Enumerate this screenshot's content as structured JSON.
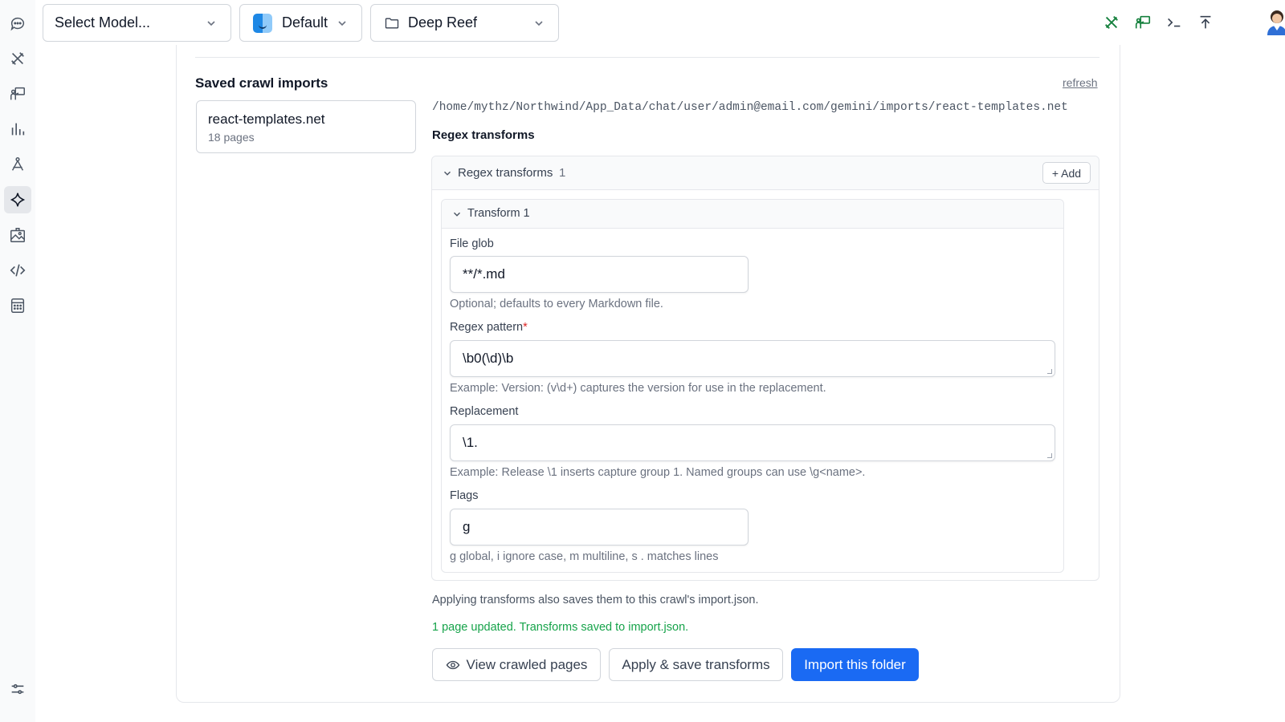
{
  "rail": {
    "items": [
      {
        "icon": "chat-icon"
      },
      {
        "icon": "tools-icon"
      },
      {
        "icon": "teacher-icon"
      },
      {
        "icon": "analytics-icon"
      },
      {
        "icon": "compass-icon"
      },
      {
        "icon": "sparkle-icon",
        "active": true
      },
      {
        "icon": "image-gallery-icon"
      },
      {
        "icon": "code-icon"
      },
      {
        "icon": "calculator-icon"
      }
    ],
    "bottom_icon": "settings-sliders-icon"
  },
  "topbar": {
    "model_select": {
      "value": "Select Model..."
    },
    "profile_select": {
      "value": "Default"
    },
    "folder_select": {
      "value": "Deep Reef"
    },
    "right_icons": [
      "tools-icon",
      "teacher-icon",
      "terminal-icon",
      "upload-icon",
      "user-avatar"
    ]
  },
  "main": {
    "section_title": "Saved crawl imports",
    "refresh_label": "refresh",
    "imports": [
      {
        "name": "react-templates.net",
        "pages": "18 pages"
      }
    ],
    "path": "/home/mythz/Northwind/App_Data/chat/user/admin@email.com/gemini/imports/react-templates.net",
    "regex_heading": "Regex transforms",
    "regex_panel": {
      "title": "Regex transforms",
      "count": "1",
      "add_label": "+ Add",
      "transform": {
        "title": "Transform 1",
        "file_glob": {
          "label": "File glob",
          "value": "**/*.md",
          "help": "Optional; defaults to every Markdown file."
        },
        "regex_pattern": {
          "label": "Regex pattern",
          "required_mark": "*",
          "value": "\\b0(\\d)\\b",
          "help": "Example: Version: (v\\d+) captures the version for use in the replacement."
        },
        "replacement": {
          "label": "Replacement",
          "value": "\\1.",
          "help": "Example: Release \\1 inserts capture group 1. Named groups can use \\g<name>."
        },
        "flags": {
          "label": "Flags",
          "value": "g",
          "help": "g global, i ignore case, m multiline, s . matches lines"
        }
      }
    },
    "apply_note": "Applying transforms also saves them to this crawl's import.json.",
    "success_note": "1 page updated. Transforms saved to import.json.",
    "buttons": {
      "view": "View crawled pages",
      "apply": "Apply & save transforms",
      "import": "Import this folder"
    }
  },
  "colors": {
    "primary": "#1a6af3",
    "success": "#16a34a",
    "required": "#dc2626",
    "accent_green": "#15803d"
  }
}
